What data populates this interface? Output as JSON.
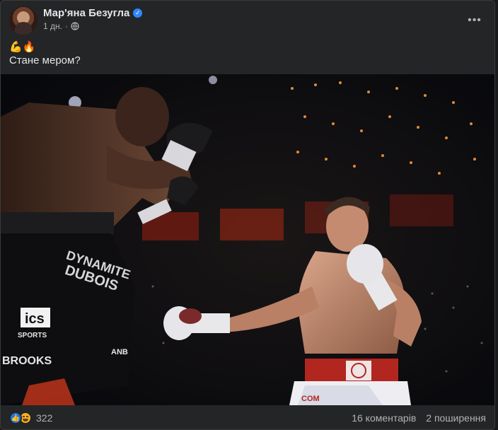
{
  "post": {
    "author": "Мар'яна Безугла",
    "time": "1 дн.",
    "emojis": "💪🔥",
    "text": "Стане мером?",
    "photo_text": {
      "shorts_brand": "DYNAMITE",
      "shorts_name": "DUBOIS",
      "sponsor_ics": "ics",
      "sponsor_sport": "SPORTS",
      "sponsor_brooks": "BROOKS",
      "sponsor_small": "ANB",
      "trunks_text": "COM"
    }
  },
  "footer": {
    "reaction_count": "322",
    "comments": "16 коментарів",
    "shares": "2 поширення"
  },
  "icons": {
    "verified": "verified-badge-icon",
    "privacy": "globe-icon",
    "more": "more-options-icon",
    "like": "like-reaction-icon",
    "haha": "haha-reaction-icon"
  },
  "colors": {
    "background": "#242526",
    "text_primary": "#e4e6eb",
    "text_secondary": "#b0b3b8",
    "verified_blue": "#2d88ff",
    "like_blue": "#1877f2"
  }
}
